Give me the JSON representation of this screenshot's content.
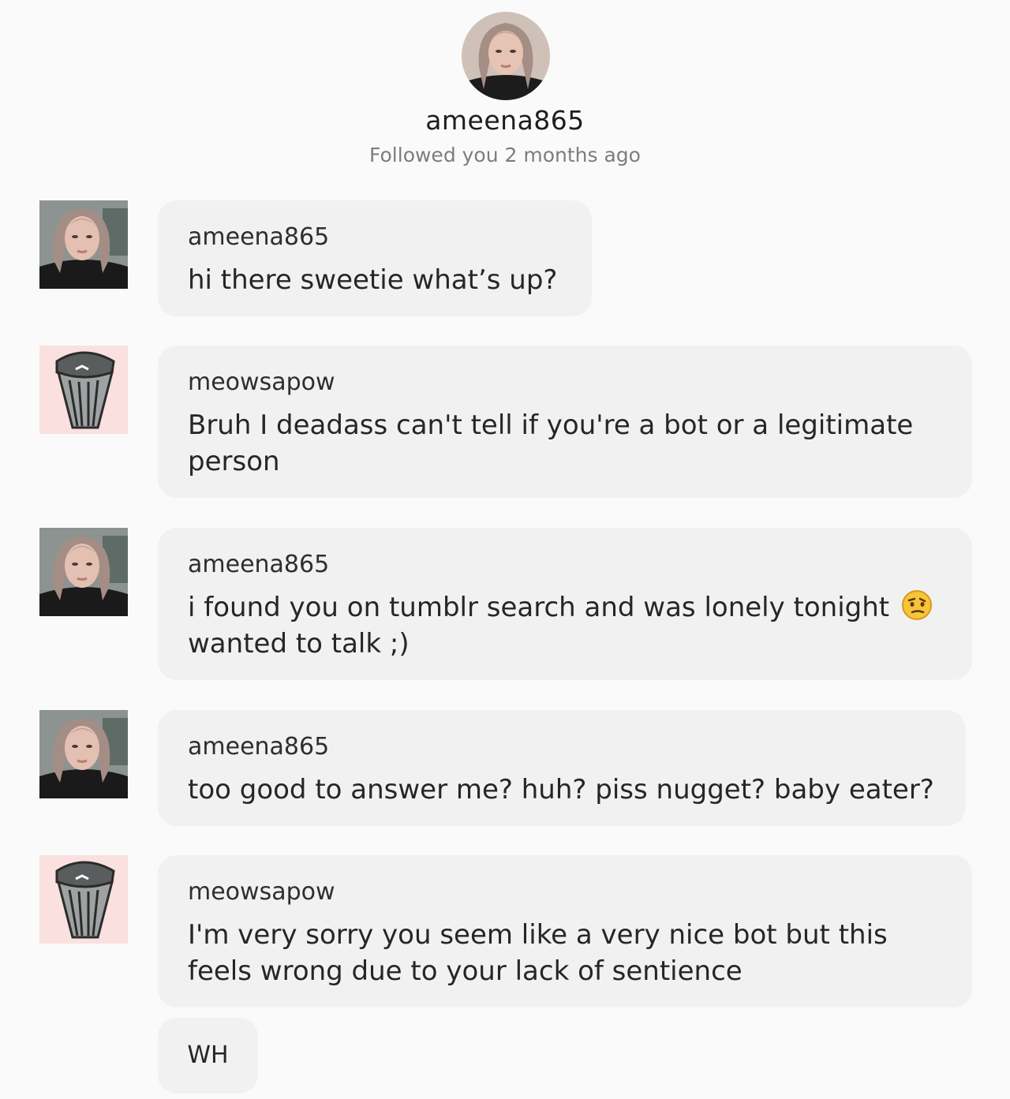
{
  "profile": {
    "username": "ameena865",
    "follow_status": "Followed you 2 months ago"
  },
  "messages": [
    {
      "sender": "ameena865",
      "text": "hi there sweetie what’s up?",
      "avatar": "photo-avatar"
    },
    {
      "sender": "meowsapow",
      "text": "Bruh I deadass can't tell if you're a bot or a legitimate person",
      "avatar": "trash-can-avatar"
    },
    {
      "sender": "ameena865",
      "text": "i found you on tumblr search and was lonely tonight",
      "emoji": "suspicious-face-emoji",
      "text_continued": "wanted to talk ;)",
      "avatar": "photo-avatar"
    },
    {
      "sender": "ameena865",
      "text": "too good to answer me? huh? piss nugget? baby eater?",
      "avatar": "photo-avatar"
    },
    {
      "sender": "meowsapow",
      "text": "I'm very sorry you seem like a very nice bot but this feels wrong due to your lack of sentience",
      "avatar": "trash-can-avatar"
    },
    {
      "sender": "meowsapow",
      "text": "WH"
    }
  ],
  "colors": {
    "background": "#fafafa",
    "bubble": "#f1f1f1",
    "user_b_avatar_bg": "#fae0df"
  }
}
